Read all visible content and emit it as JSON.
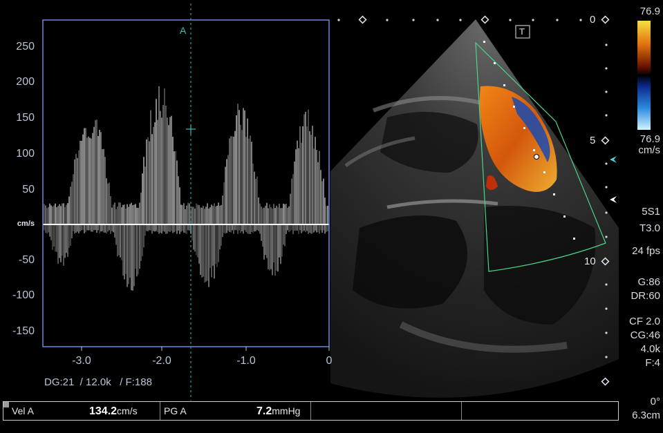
{
  "doppler": {
    "marker_label": "A",
    "unit_label": "cm/s",
    "y_ticks": [
      "250",
      "200",
      "150",
      "100",
      "50",
      "-50",
      "-100",
      "-150"
    ],
    "x_ticks": [
      "-3.0",
      "-2.0",
      "-1.0",
      "0"
    ],
    "settings": "DG:21  / 12.0k   / F:188"
  },
  "echo": {
    "depth_labels": [
      "0",
      "5",
      "10"
    ],
    "t_marker": "T"
  },
  "color_scale": {
    "top_value": "76.9",
    "bottom_value": "76.9",
    "unit": "cm/s",
    "colors": [
      "#f7e040",
      "#e07010",
      "#8a1a00",
      "#000000",
      "#0a2a8a",
      "#2a8ae0",
      "#c8f0ff"
    ]
  },
  "params": {
    "probe": "5S1",
    "tis": "T3.0",
    "fps": "24 fps",
    "gain": "G:86",
    "dr": "DR:60",
    "cf": "CF 2.0",
    "cg": "CG:46",
    "freq": "4.0k",
    "filter": "F:4",
    "angle": "0°",
    "depth": "6.3cm"
  },
  "measurements": {
    "vel_label": "Vel A",
    "vel_value": "134.2",
    "vel_unit": "cm/s",
    "pg_label": "PG A",
    "pg_value": "7.2",
    "pg_unit": "mmHg"
  }
}
